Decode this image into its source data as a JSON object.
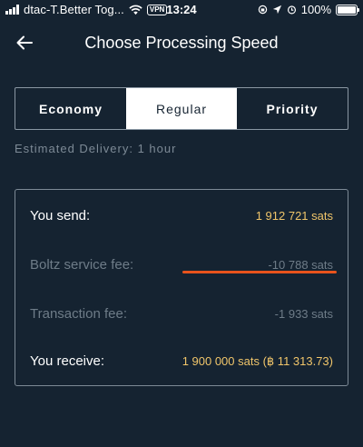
{
  "status_bar": {
    "carrier": "dtac-T.Better Tog...",
    "vpn": "VPN",
    "time": "13:24",
    "battery": "100%"
  },
  "header": {
    "title": "Choose Processing Speed"
  },
  "speed_selector": {
    "options": [
      "Economy",
      "Regular",
      "Priority"
    ],
    "selected": "Regular"
  },
  "delivery": {
    "text": "Estimated Delivery: 1 hour"
  },
  "fees": {
    "send_label": "You send:",
    "send_value": "1 912 721 sats",
    "boltz_label": "Boltz service fee:",
    "boltz_value": "-10 788 sats",
    "tx_label": "Transaction fee:",
    "tx_value": "-1 933 sats",
    "receive_label": "You receive:",
    "receive_value": "1 900 000 sats (฿ 11 313.73)"
  },
  "colors": {
    "background": "#152331",
    "accent_gold": "#f0c56a",
    "annotation": "#e8531c"
  }
}
